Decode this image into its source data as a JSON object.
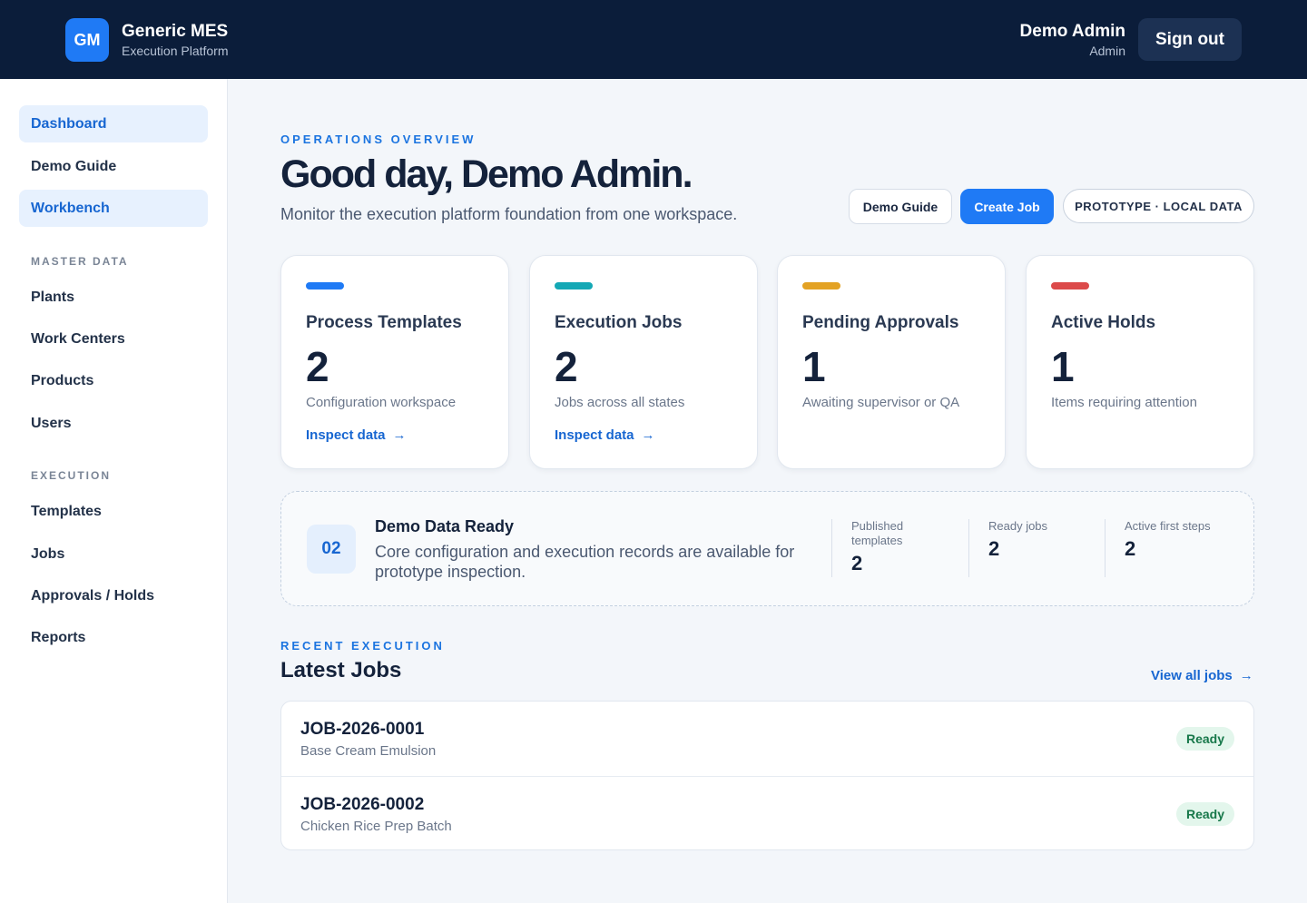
{
  "header": {
    "logo_initials": "GM",
    "app_name": "Generic MES",
    "app_subtitle": "Execution Platform",
    "user_name": "Demo Admin",
    "user_role": "Admin",
    "signout_label": "Sign out"
  },
  "sidebar": {
    "top_items": [
      {
        "label": "Dashboard",
        "active": true
      },
      {
        "label": "Demo Guide",
        "active": false
      },
      {
        "label": "Workbench",
        "active": true
      }
    ],
    "master_data_heading": "MASTER DATA",
    "master_data_items": [
      "Plants",
      "Work Centers",
      "Products",
      "Users"
    ],
    "execution_heading": "EXECUTION",
    "execution_items": [
      "Templates",
      "Jobs",
      "Approvals / Holds",
      "Reports"
    ]
  },
  "hero": {
    "eyebrow": "OPERATIONS OVERVIEW",
    "title": "Good day, Demo Admin.",
    "subtitle": "Monitor the execution platform foundation from one workspace.",
    "demo_guide_label": "Demo Guide",
    "create_job_label": "Create Job",
    "mode_pill": "PROTOTYPE · LOCAL DATA"
  },
  "cards": [
    {
      "title": "Process Templates",
      "value": "2",
      "desc": "Configuration workspace",
      "link": "Inspect data",
      "color": "#1f7af5"
    },
    {
      "title": "Execution Jobs",
      "value": "2",
      "desc": "Jobs across all states",
      "link": "Inspect data",
      "color": "#14a8b5"
    },
    {
      "title": "Pending Approvals",
      "value": "1",
      "desc": "Awaiting supervisor or QA",
      "color": "#e3a224"
    },
    {
      "title": "Active Holds",
      "value": "1",
      "desc": "Items requiring attention",
      "color": "#dc4a4a"
    }
  ],
  "demo": {
    "step": "02",
    "title": "Demo Data Ready",
    "desc": "Core configuration and execution records are available for prototype inspection.",
    "stats": [
      {
        "label": "Published templates",
        "value": "2"
      },
      {
        "label": "Ready jobs",
        "value": "2"
      },
      {
        "label": "Active first steps",
        "value": "2"
      }
    ]
  },
  "recent": {
    "eyebrow": "RECENT EXECUTION",
    "title": "Latest Jobs",
    "view_all": "View all jobs",
    "jobs": [
      {
        "id": "JOB-2026-0001",
        "name": "Base Cream Emulsion",
        "status": "Ready"
      },
      {
        "id": "JOB-2026-0002",
        "name": "Chicken Rice Prep Batch",
        "status": "Ready"
      }
    ]
  },
  "icons": {
    "arrow": "arrow-right-icon"
  }
}
